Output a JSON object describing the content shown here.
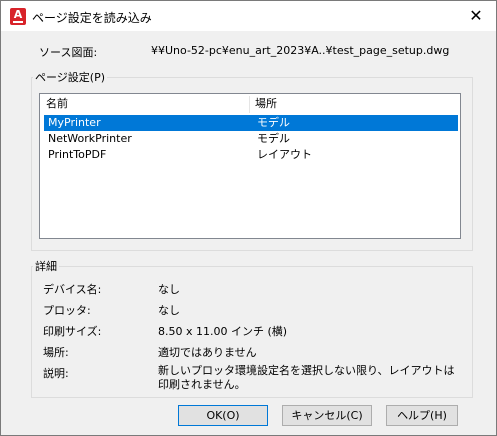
{
  "window": {
    "title": "ページ設定を読み込み",
    "close_glyph": "✕"
  },
  "app_icon_letter": "A",
  "source": {
    "label": "ソース図面:",
    "value": "¥¥Uno-52-pc¥enu_art_2023¥A..¥test_page_setup.dwg"
  },
  "page_setups": {
    "group_label": "ページ設定(P)",
    "columns": [
      "名前",
      "場所"
    ],
    "rows": [
      {
        "name": "MyPrinter",
        "location": "モデル"
      },
      {
        "name": "NetWorkPrinter",
        "location": "モデル"
      },
      {
        "name": "PrintToPDF",
        "location": "レイアウト"
      }
    ],
    "selected_index": 0
  },
  "details": {
    "group_label": "詳細",
    "fields": [
      {
        "label": "デバイス名:",
        "value": "なし"
      },
      {
        "label": "プロッタ:",
        "value": "なし"
      },
      {
        "label": "印刷サイズ:",
        "value": "8.50 x 11.00 インチ (横)"
      },
      {
        "label": "場所:",
        "value": "適切ではありません"
      },
      {
        "label": "説明:",
        "value": "新しいプロッタ環境設定名を選択しない限り、レイアウトは印刷されません。"
      }
    ]
  },
  "buttons": {
    "ok": "OK(O)",
    "cancel": "キャンセル(C)",
    "help": "ヘルプ(H)"
  }
}
